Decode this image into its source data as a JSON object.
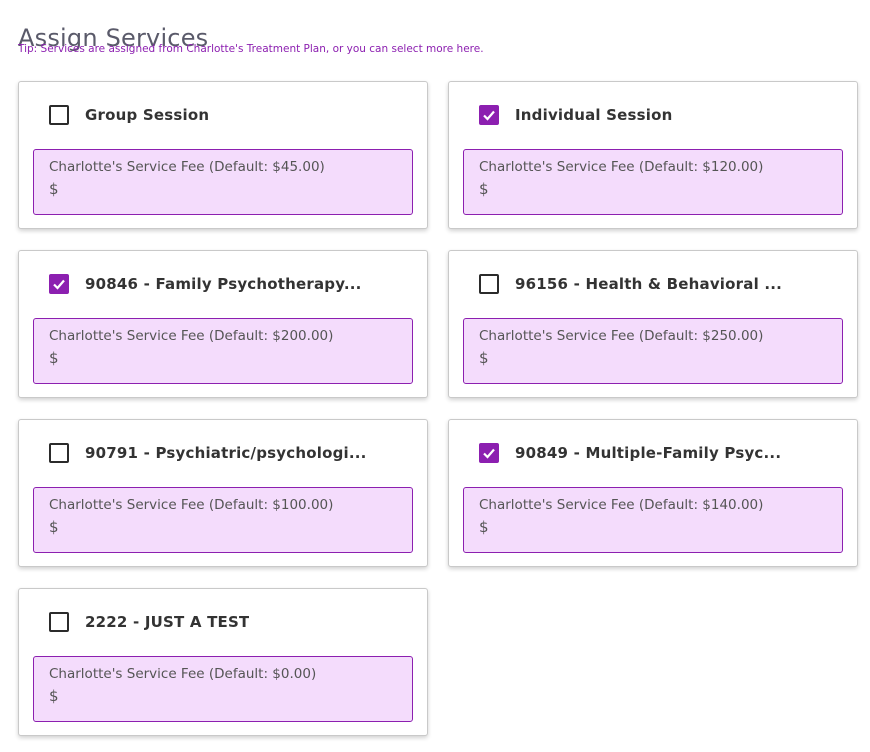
{
  "page": {
    "title": "Assign Services",
    "tip": "Tip: Services are assigned from Charlotte's Treatment Plan, or you can select more here."
  },
  "colors": {
    "accent": "#8c1fb0",
    "fee_bg": "#f4dcfc",
    "title": "#5a5a6a"
  },
  "services": [
    {
      "name": "Group Session",
      "checked": false,
      "fee_label": "Charlotte's Service Fee (Default: $45.00)",
      "currency": "$",
      "value": ""
    },
    {
      "name": "Individual Session",
      "checked": true,
      "fee_label": "Charlotte's Service Fee (Default: $120.00)",
      "currency": "$",
      "value": ""
    },
    {
      "name": "90846 - Family Psychotherapy...",
      "checked": true,
      "fee_label": "Charlotte's Service Fee (Default: $200.00)",
      "currency": "$",
      "value": ""
    },
    {
      "name": "96156 - Health & Behavioral ...",
      "checked": false,
      "fee_label": "Charlotte's Service Fee (Default: $250.00)",
      "currency": "$",
      "value": ""
    },
    {
      "name": "90791 - Psychiatric/psychologi...",
      "checked": false,
      "fee_label": "Charlotte's Service Fee (Default: $100.00)",
      "currency": "$",
      "value": ""
    },
    {
      "name": "90849 - Multiple-Family Psyc...",
      "checked": true,
      "fee_label": "Charlotte's Service Fee (Default: $140.00)",
      "currency": "$",
      "value": ""
    },
    {
      "name": "2222 - JUST A TEST",
      "checked": false,
      "fee_label": "Charlotte's Service Fee (Default: $0.00)",
      "currency": "$",
      "value": ""
    }
  ]
}
